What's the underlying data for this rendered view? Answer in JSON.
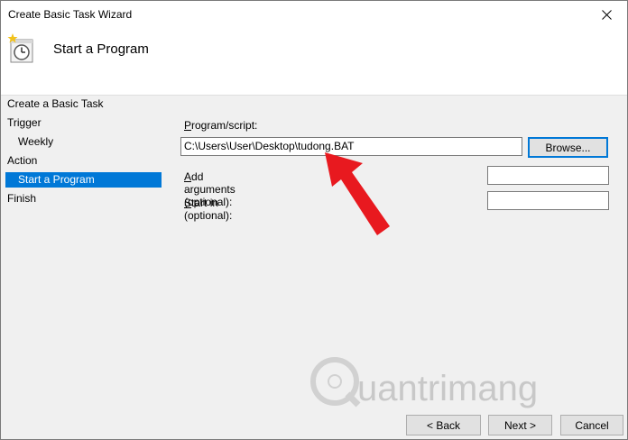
{
  "window": {
    "title": "Create Basic Task Wizard"
  },
  "header": {
    "title": "Start a Program",
    "icon": "task-scheduler-clock-icon"
  },
  "sidebar": {
    "steps": [
      {
        "label": "Create a Basic Task",
        "indent": false,
        "selected": false
      },
      {
        "label": "Trigger",
        "indent": false,
        "selected": false
      },
      {
        "label": "Weekly",
        "indent": true,
        "selected": false
      },
      {
        "label": "Action",
        "indent": false,
        "selected": false
      },
      {
        "label": "Start a Program",
        "indent": true,
        "selected": true
      },
      {
        "label": "Finish",
        "indent": false,
        "selected": false
      }
    ]
  },
  "form": {
    "program_label": "Program/script:",
    "program_value": "C:\\Users\\User\\Desktop\\tudong.BAT",
    "browse_label": "Browse...",
    "arguments_label": "Add arguments (optional):",
    "arguments_value": "",
    "startin_label": "Start in (optional):",
    "startin_value": ""
  },
  "buttons": {
    "back_label": "Back",
    "next_label": "Next >",
    "cancel_label": "Cancel"
  },
  "watermark": {
    "text": "uantrimang"
  },
  "colors": {
    "selection": "#0078d7",
    "arrow": "#e8191f"
  }
}
